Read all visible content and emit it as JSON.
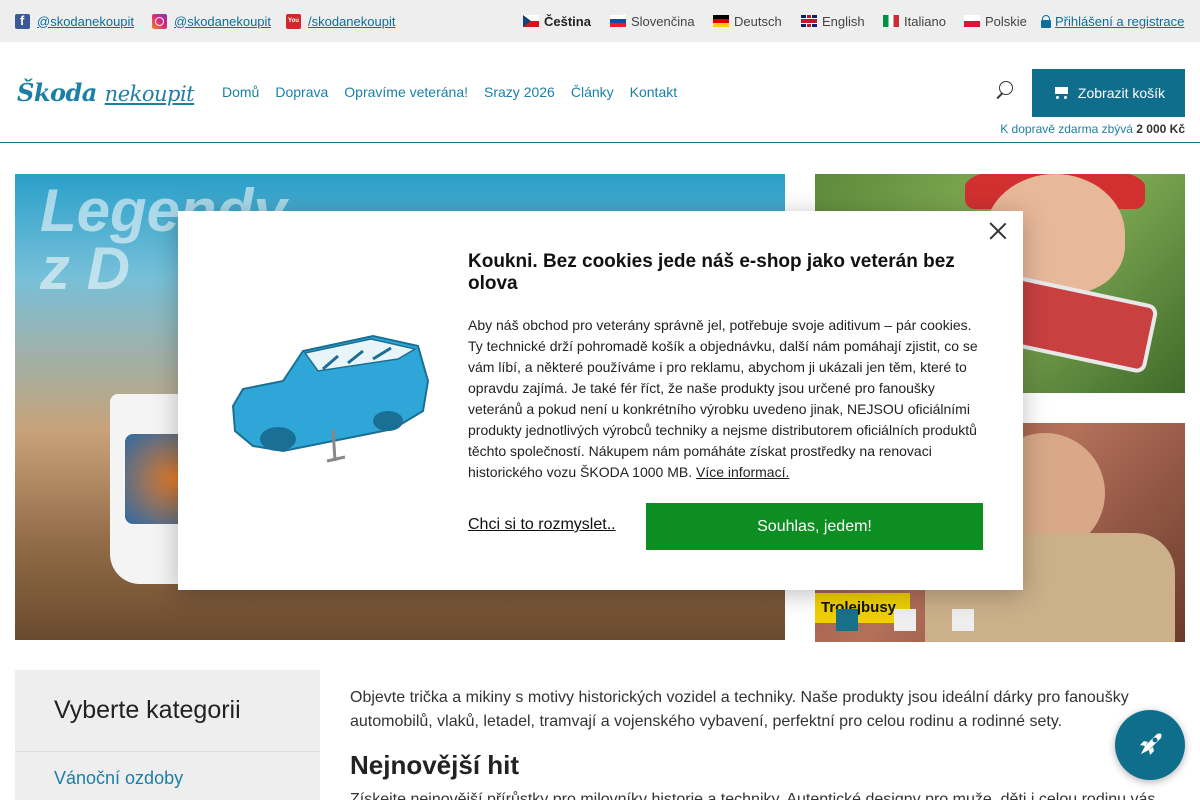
{
  "social": {
    "facebook": "@skodanekoupit",
    "instagram": "@skodanekoupit",
    "youtube": "/skodanekoupit",
    "youtube_icon_text": "You"
  },
  "languages": [
    {
      "label": "Čeština",
      "flag": "flag-cz-icon",
      "active": true
    },
    {
      "label": "Slovenčina",
      "flag": "flag-sk-icon"
    },
    {
      "label": "Deutsch",
      "flag": "flag-de-icon"
    },
    {
      "label": "English",
      "flag": "flag-gb-icon"
    },
    {
      "label": "Italiano",
      "flag": "flag-it-icon"
    },
    {
      "label": "Polskie",
      "flag": "flag-pl-icon"
    }
  ],
  "login_label": "Přihlášení a registrace",
  "logo": {
    "part1": "Škoda",
    "part2": "nekoupit"
  },
  "nav": [
    "Domů",
    "Doprava",
    "Opravíme veterána!",
    "Srazy 2026",
    "Články",
    "Kontakt"
  ],
  "cart": {
    "label": "Zobrazit košík",
    "shipping_prefix": "K dopravě zdarma zbývá",
    "shipping_amount": "2 000 Kč"
  },
  "hero": {
    "main_heading_line1": "Legendy",
    "main_heading_line2": "z D",
    "side2_badge": "Trolejbusy"
  },
  "categories": {
    "title": "Vyberte kategorii",
    "first_item": "Vánoční ozdoby"
  },
  "content": {
    "intro": "Objevte trička a mikiny s motivy historických vozidel a techniky. Naše produkty jsou ideální dárky pro fanoušky automobilů, vlaků, letadel, tramvají a vojenského vybavení, perfektní pro celou rodinu a rodinné sety.",
    "heading": "Nejnovější hit",
    "intro2": "Získejte nejnovější přírůstky pro milovníky historie a techniky. Autentické designy pro muže, děti i celou rodinu vás"
  },
  "modal": {
    "title": "Koukni. Bez cookies jede náš e-shop jako veterán bez olova",
    "body": "Aby náš obchod pro veterány správně jel, potřebuje svoje aditivum – pár cookies. Ty technické drží pohromadě košík a objednávku, další nám pomáhají zjistit, co se vám líbí, a některé používáme i pro reklamu, abychom ji ukázali jen těm, které to opravdu zajímá. Je také fér říct, že naše produkty jsou určené pro fanoušky veteránů a pokud není u konkrétního výrobku uvedeno jinak, NEJSOU oficiálními produkty jednotlivých výrobců techniky a nejsme distributorem oficiálních produktů těchto společností. Nákupem nám pomáháte získat prostředky na renovaci historického vozu ŠKODA 1000 MB.",
    "more_link": "Více informací.",
    "later_label": "Chci si to rozmyslet..",
    "agree_label": "Souhlas, jedem!"
  },
  "colors": {
    "accent": "#106e8d",
    "agree": "#0c8e23",
    "link": "#1a80a8"
  }
}
